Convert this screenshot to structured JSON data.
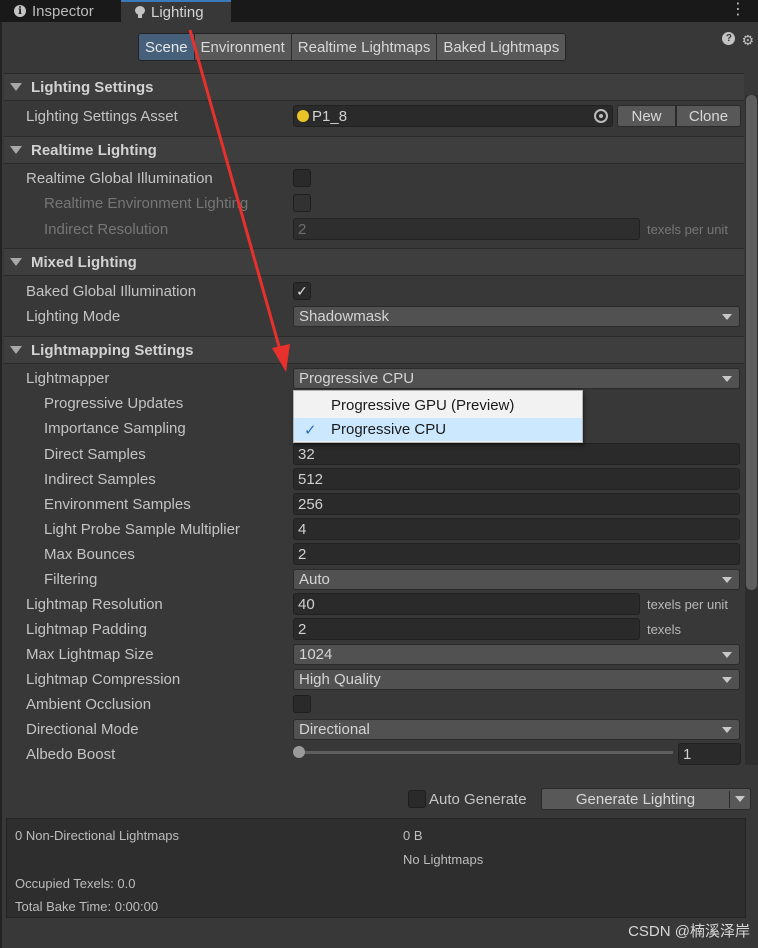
{
  "tabs": {
    "inspector": "Inspector",
    "lighting": "Lighting",
    "kebab": "⋮"
  },
  "header_tabs": [
    "Scene",
    "Environment",
    "Realtime Lightmaps",
    "Baked Lightmaps"
  ],
  "active_header_tab": "Scene",
  "lighting_settings": {
    "title": "Lighting Settings",
    "asset_label": "Lighting Settings Asset",
    "asset_value": "P1_8",
    "new_label": "New",
    "clone_label": "Clone"
  },
  "realtime": {
    "title": "Realtime Lighting",
    "gi_label": "Realtime Global Illumination",
    "env_label": "Realtime Environment Lighting",
    "indirect_label": "Indirect Resolution",
    "indirect_value": "2",
    "indirect_unit": "texels per unit"
  },
  "mixed": {
    "title": "Mixed Lighting",
    "baked_gi_label": "Baked Global Illumination",
    "baked_gi_checked": "✓",
    "mode_label": "Lighting Mode",
    "mode_value": "Shadowmask"
  },
  "lightmapping": {
    "title": "Lightmapping Settings",
    "lightmapper_label": "Lightmapper",
    "lightmapper_value": "Progressive CPU",
    "progressive_updates_label": "Progressive Updates",
    "importance_label": "Importance Sampling",
    "direct_label": "Direct Samples",
    "direct_value": "32",
    "indirect_label": "Indirect Samples",
    "indirect_value": "512",
    "env_label": "Environment Samples",
    "env_value": "256",
    "probe_label": "Light Probe Sample Multiplier",
    "probe_value": "4",
    "bounces_label": "Max Bounces",
    "bounces_value": "2",
    "filtering_label": "Filtering",
    "filtering_value": "Auto",
    "resolution_label": "Lightmap Resolution",
    "resolution_value": "40",
    "resolution_unit": "texels per unit",
    "padding_label": "Lightmap Padding",
    "padding_value": "2",
    "padding_unit": "texels",
    "maxsize_label": "Max Lightmap Size",
    "maxsize_value": "1024",
    "compression_label": "Lightmap Compression",
    "compression_value": "High Quality",
    "ao_label": "Ambient Occlusion",
    "directional_label": "Directional Mode",
    "directional_value": "Directional",
    "albedo_label": "Albedo Boost",
    "albedo_value": "1"
  },
  "popup": {
    "options": [
      "Progressive GPU (Preview)",
      "Progressive CPU"
    ],
    "selected": "Progressive CPU",
    "check": "✓"
  },
  "bake": {
    "auto_generate_label": "Auto Generate",
    "generate_label": "Generate Lighting"
  },
  "info": {
    "lightmaps": "0 Non-Directional Lightmaps",
    "size": "0 B",
    "no_lightmaps": "No Lightmaps",
    "occupied": "Occupied Texels: 0.0",
    "bake_time": "Total Bake Time: 0:00:00"
  },
  "watermark": "CSDN @楠溪泽岸",
  "colors": {
    "accent": "#3a79bb",
    "active_tab": "#46607c",
    "arrow": "#e8302c"
  }
}
